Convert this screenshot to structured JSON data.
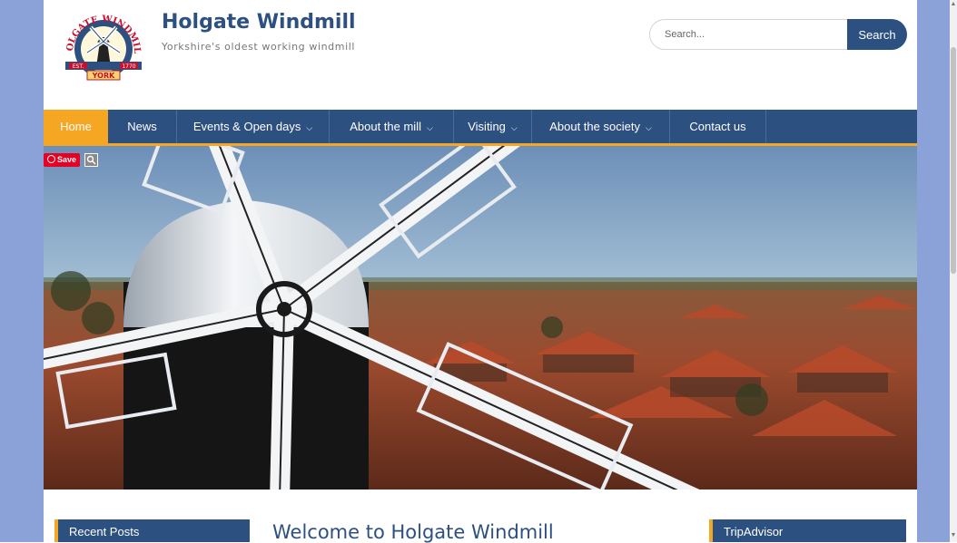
{
  "site": {
    "title": "Holgate Windmill",
    "tagline": "Yorkshire's oldest working windmill",
    "logo": {
      "arc_text": "HOLGATE WINDMILL",
      "est": "EST.",
      "year": "1770",
      "city": "YORK"
    }
  },
  "search": {
    "placeholder": "Search...",
    "value": "",
    "button_label": "Search"
  },
  "nav": {
    "items": [
      {
        "label": "Home",
        "active": true,
        "has_dropdown": false
      },
      {
        "label": "News",
        "active": false,
        "has_dropdown": false
      },
      {
        "label": "Events & Open days",
        "active": false,
        "has_dropdown": true
      },
      {
        "label": "About the mill",
        "active": false,
        "has_dropdown": true
      },
      {
        "label": "Visiting",
        "active": false,
        "has_dropdown": true
      },
      {
        "label": "About the society",
        "active": false,
        "has_dropdown": true
      },
      {
        "label": "Contact us",
        "active": false,
        "has_dropdown": false
      }
    ],
    "chevron_icon": "chevron-down-icon"
  },
  "hero": {
    "save_label": "Save",
    "save_icon": "pinterest-icon",
    "visual_search_icon": "magnifier-icon"
  },
  "content": {
    "heading": "Welcome to Holgate Windmill"
  },
  "sidebar_left": {
    "title": "Recent Posts"
  },
  "sidebar_right": {
    "title": "TripAdvisor"
  },
  "colors": {
    "primary": "#2c5080",
    "accent": "#f5a623",
    "page_bg": "#8aa2d8",
    "pinterest": "#e60023"
  }
}
